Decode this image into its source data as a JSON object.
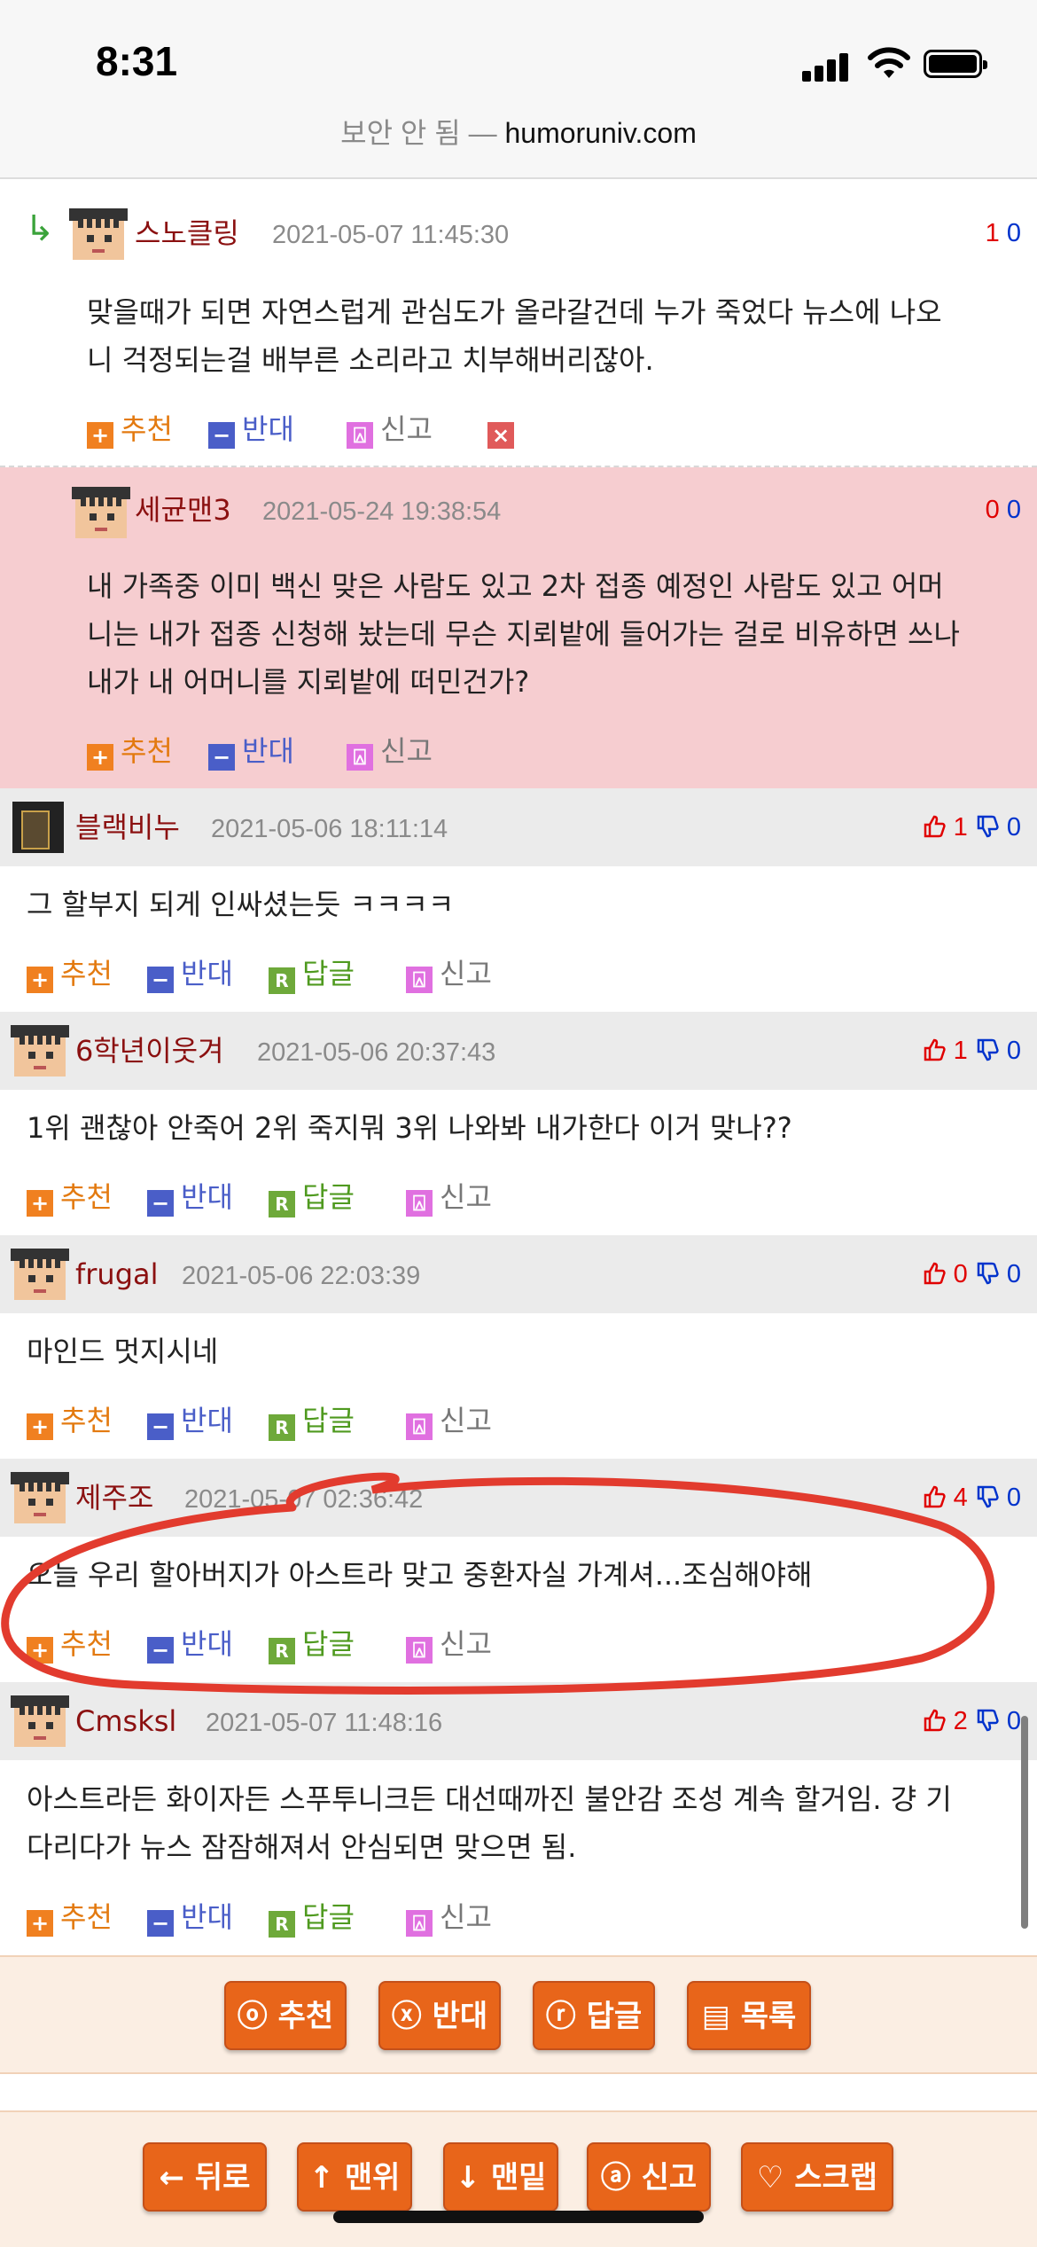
{
  "status_bar": {
    "time": "8:31"
  },
  "address_bar": {
    "insecure_label": "보안 안 됨 —",
    "host": "humoruniv.com"
  },
  "action_labels": {
    "recommend": "추천",
    "oppose": "반대",
    "reply": "답글",
    "report": "신고"
  },
  "comments": [
    {
      "author": "스노클링",
      "date": "2021-05-07 11:45:30",
      "up": "1",
      "down": "0",
      "lines": [
        "맞을때가 되면 자연스럽게 관심도가 올라갈건데 누가 죽었다 뉴스에 나오",
        "니 걱정되는걸 배부른 소리라고 치부해버리잖아."
      ]
    },
    {
      "author": "세균맨3",
      "date": "2021-05-24 19:38:54",
      "up": "0",
      "down": "0",
      "lines": [
        "내 가족중 이미 백신 맞은 사람도 있고 2차 접종 예정인 사람도 있고 어머",
        "니는 내가 접종 신청해 놨는데 무슨 지뢰밭에 들어가는 걸로 비유하면 쓰나",
        "내가 내 어머니를 지뢰밭에 떠민건가?"
      ]
    },
    {
      "author": "블랙비누",
      "date": "2021-05-06 18:11:14",
      "up": "1",
      "down": "0",
      "lines": [
        "그 할부지 되게 인싸셨는듯 ㅋㅋㅋㅋ"
      ]
    },
    {
      "author": "6학년이웃겨",
      "date": "2021-05-06 20:37:43",
      "up": "1",
      "down": "0",
      "lines": [
        "1위 괜찮아 안죽어 2위 죽지뭐 3위 나와봐 내가한다 이거 맞나??"
      ]
    },
    {
      "author": "frugal",
      "date": "2021-05-06 22:03:39",
      "up": "0",
      "down": "0",
      "lines": [
        "마인드 멋지시네"
      ]
    },
    {
      "author": "제주조",
      "date": "2021-05-07 02:36:42",
      "up": "4",
      "down": "0",
      "lines": [
        "오늘 우리 할아버지가 아스트라 맞고 중환자실 가계셔...조심해야해"
      ]
    },
    {
      "author": "Cmsksl",
      "date": "2021-05-07 11:48:16",
      "up": "2",
      "down": "0",
      "lines": [
        "아스트라든 화이자든 스푸투니크든 대선때까진 불안감 조성 계속 할거임. 걍 기",
        "다리다가 뉴스 잠잠해져서 안심되면 맞으면 됨."
      ]
    }
  ],
  "post_buttons": [
    "ⓞ 추천",
    "ⓧ 반대",
    "ⓡ 답글",
    "▤ 목록"
  ],
  "nav_buttons": [
    "← 뒤로",
    "↑ 맨위",
    "↓ 맨밑",
    "ⓐ 신고",
    "♡ 스크랩"
  ],
  "colors": {
    "accent_orange": "#e8651a",
    "name_red": "#8b1010",
    "highlight_pink": "#f6cdd0",
    "annotation_red": "#e23b2e"
  }
}
